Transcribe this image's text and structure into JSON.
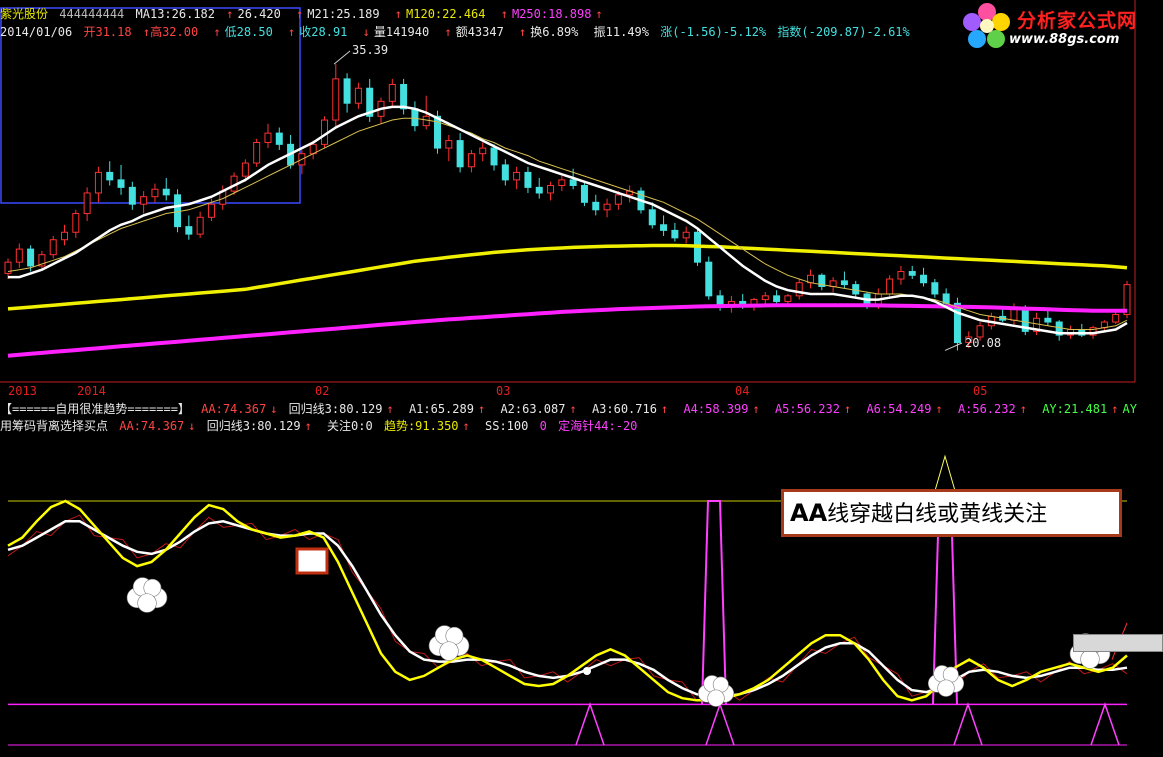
{
  "header": {
    "stock_name": "紫光股份",
    "code": "444444444",
    "ma13": "MA13:26.182",
    "ma13_arrow": "26.420",
    "ma21": "M21:25.189",
    "ma120": "M120:22.464",
    "ma250": "M250:18.898"
  },
  "quote": {
    "date": "2014/01/06",
    "open": "开31.18",
    "high": "高32.00",
    "low": "低28.50",
    "close": "收28.91",
    "volume": "量141940",
    "amount": "额43347",
    "turnover": "换6.89%",
    "amplitude": "振11.49%",
    "change": "涨(-1.56)-5.12%",
    "index": "指数(-209.87)-2.61%"
  },
  "indicator_row1": {
    "title": "【======自用很准趋势=======】",
    "aa": "AA:74.367",
    "huigui": "回归线3:80.129",
    "a1": "A1:65.289",
    "a2": "A2:63.087",
    "a3": "A3:60.716",
    "a4": "A4:58.399",
    "a5": "A5:56.232",
    "a6": "A6:54.249",
    "a": "A:56.232",
    "ay": "AY:21.481",
    "ay2": "AY"
  },
  "indicator_row2": {
    "title": "用筹码背离选择买点",
    "aa": "AA:74.367",
    "huigui": "回归线3:80.129",
    "guanzhu": "关注0:0",
    "qushi": "趋势:91.350",
    "ss": "SS:100",
    "zero": "0",
    "dinghai": "定海针44:-20"
  },
  "price_labels": {
    "high": "35.39",
    "low": "20.08"
  },
  "x_axis": [
    "2013",
    "2014",
    "02",
    "03",
    "04",
    "05"
  ],
  "logo": {
    "title": "分析家公式网",
    "url": "www.88gs.com"
  },
  "annotation": {
    "bold": "AA",
    "text": "线穿越白线或黄线关注"
  },
  "colors": {
    "up": "#ff3030",
    "down": "#44e0e0",
    "ma13": "#ffffff",
    "ma21": "#e8e8e8",
    "ma120": "#f0f000",
    "ma250": "#ff20ff",
    "aa": "#ffff00",
    "ref": "#ffffff"
  },
  "chart_data": [
    {
      "type": "candlestick",
      "title": "紫光股份",
      "x_ticks": [
        "2013",
        "2014",
        "02",
        "03",
        "04",
        "05"
      ],
      "ylim": [
        18.5,
        37
      ],
      "candles": [
        [
          24.2,
          25.0,
          23.9,
          24.8
        ],
        [
          24.8,
          25.8,
          24.5,
          25.5
        ],
        [
          25.5,
          25.7,
          24.3,
          24.6
        ],
        [
          24.6,
          25.4,
          24.4,
          25.2
        ],
        [
          25.2,
          26.2,
          25.0,
          26.0
        ],
        [
          26.0,
          26.8,
          25.7,
          26.4
        ],
        [
          26.4,
          27.6,
          26.1,
          27.4
        ],
        [
          27.4,
          28.8,
          27.0,
          28.5
        ],
        [
          28.5,
          29.9,
          28.0,
          29.6
        ],
        [
          29.6,
          30.2,
          28.9,
          29.2
        ],
        [
          29.2,
          30.0,
          28.4,
          28.8
        ],
        [
          28.8,
          29.1,
          27.6,
          27.9
        ],
        [
          27.9,
          28.6,
          27.4,
          28.3
        ],
        [
          28.3,
          29.0,
          28.0,
          28.7
        ],
        [
          28.7,
          29.3,
          28.1,
          28.4
        ],
        [
          28.4,
          28.7,
          26.4,
          26.7
        ],
        [
          26.7,
          27.3,
          26.0,
          26.3
        ],
        [
          26.3,
          27.5,
          26.1,
          27.2
        ],
        [
          27.2,
          28.2,
          27.0,
          27.9
        ],
        [
          27.9,
          28.9,
          27.6,
          28.6
        ],
        [
          28.6,
          29.6,
          28.4,
          29.4
        ],
        [
          29.4,
          30.3,
          29.1,
          30.1
        ],
        [
          30.1,
          31.4,
          29.9,
          31.2
        ],
        [
          31.2,
          32.2,
          30.9,
          31.7
        ],
        [
          31.7,
          32.0,
          30.8,
          31.1
        ],
        [
          31.1,
          31.6,
          29.8,
          30.0
        ],
        [
          30.0,
          30.8,
          29.5,
          30.6
        ],
        [
          30.6,
          31.3,
          30.3,
          31.1
        ],
        [
          31.1,
          32.6,
          30.9,
          32.4
        ],
        [
          32.4,
          35.39,
          32.0,
          34.6
        ],
        [
          34.6,
          34.9,
          32.8,
          33.3
        ],
        [
          33.3,
          34.4,
          33.0,
          34.1
        ],
        [
          34.1,
          34.6,
          32.3,
          32.6
        ],
        [
          32.6,
          33.6,
          32.2,
          33.4
        ],
        [
          33.4,
          34.6,
          33.1,
          34.3
        ],
        [
          34.3,
          34.6,
          32.7,
          33.0
        ],
        [
          33.0,
          33.4,
          31.8,
          32.1
        ],
        [
          32.1,
          33.7,
          31.9,
          32.6
        ],
        [
          32.6,
          32.9,
          30.6,
          30.9
        ],
        [
          30.9,
          31.6,
          30.2,
          31.3
        ],
        [
          31.3,
          31.7,
          29.6,
          29.9
        ],
        [
          29.9,
          30.8,
          29.6,
          30.6
        ],
        [
          30.6,
          31.2,
          30.2,
          30.9
        ],
        [
          30.9,
          31.1,
          29.7,
          30.0
        ],
        [
          30.0,
          30.3,
          28.9,
          29.2
        ],
        [
          29.2,
          29.9,
          28.7,
          29.6
        ],
        [
          29.6,
          29.9,
          28.5,
          28.8
        ],
        [
          28.8,
          29.3,
          28.2,
          28.5
        ],
        [
          28.5,
          29.1,
          28.1,
          28.9
        ],
        [
          28.9,
          29.4,
          28.6,
          29.2
        ],
        [
          29.2,
          29.8,
          28.7,
          28.9
        ],
        [
          28.9,
          29.1,
          27.8,
          28.0
        ],
        [
          28.0,
          28.4,
          27.3,
          27.6
        ],
        [
          27.6,
          28.2,
          27.2,
          27.9
        ],
        [
          27.9,
          28.6,
          27.6,
          28.4
        ],
        [
          28.4,
          28.9,
          28.0,
          28.6
        ],
        [
          28.6,
          28.8,
          27.4,
          27.6
        ],
        [
          27.6,
          28.0,
          26.6,
          26.8
        ],
        [
          26.8,
          27.3,
          26.2,
          26.5
        ],
        [
          26.5,
          26.9,
          25.9,
          26.1
        ],
        [
          26.1,
          26.7,
          25.8,
          26.4
        ],
        [
          26.4,
          26.6,
          24.6,
          24.8
        ],
        [
          24.8,
          25.1,
          22.8,
          23.0
        ],
        [
          23.0,
          23.3,
          22.2,
          22.4
        ],
        [
          22.4,
          23.0,
          22.1,
          22.7
        ],
        [
          22.7,
          23.1,
          22.3,
          22.5
        ],
        [
          22.5,
          22.9,
          22.2,
          22.8
        ],
        [
          22.8,
          23.2,
          22.5,
          23.0
        ],
        [
          23.0,
          23.3,
          22.6,
          22.7
        ],
        [
          22.7,
          23.1,
          22.4,
          23.0
        ],
        [
          23.0,
          23.9,
          22.8,
          23.7
        ],
        [
          23.7,
          24.4,
          23.4,
          24.1
        ],
        [
          24.1,
          24.2,
          23.3,
          23.5
        ],
        [
          23.5,
          24.0,
          23.2,
          23.8
        ],
        [
          23.8,
          24.3,
          23.4,
          23.6
        ],
        [
          23.6,
          23.8,
          22.9,
          23.1
        ],
        [
          23.1,
          23.2,
          22.3,
          22.5
        ],
        [
          22.5,
          23.4,
          22.3,
          23.1
        ],
        [
          23.1,
          24.1,
          22.9,
          23.9
        ],
        [
          23.9,
          24.6,
          23.6,
          24.3
        ],
        [
          24.3,
          24.6,
          23.9,
          24.1
        ],
        [
          24.1,
          24.5,
          23.5,
          23.7
        ],
        [
          23.7,
          23.9,
          22.9,
          23.1
        ],
        [
          23.1,
          23.4,
          22.4,
          22.6
        ],
        [
          22.6,
          22.9,
          20.08,
          20.5
        ],
        [
          20.5,
          21.1,
          20.2,
          20.8
        ],
        [
          20.8,
          21.6,
          20.6,
          21.4
        ],
        [
          21.4,
          22.1,
          21.2,
          21.9
        ],
        [
          21.9,
          22.3,
          21.6,
          21.7
        ],
        [
          21.7,
          22.6,
          21.4,
          22.3
        ],
        [
          22.3,
          22.5,
          20.9,
          21.1
        ],
        [
          21.1,
          22.1,
          20.9,
          21.8
        ],
        [
          21.8,
          22.2,
          21.4,
          21.6
        ],
        [
          21.6,
          21.7,
          20.6,
          20.9
        ],
        [
          20.9,
          21.4,
          20.7,
          21.2
        ],
        [
          21.2,
          21.5,
          20.8,
          20.9
        ],
        [
          20.9,
          21.4,
          20.7,
          21.3
        ],
        [
          21.3,
          21.7,
          21.1,
          21.6
        ],
        [
          21.6,
          22.2,
          21.5,
          22.0
        ],
        [
          22.0,
          23.8,
          21.8,
          23.6
        ]
      ],
      "ma_series": [
        {
          "name": "MA13",
          "values_first": 24.0,
          "values_last": 21.55
        },
        {
          "name": "M21",
          "values_first": 24.3,
          "values_last": 21.7
        },
        {
          "name": "M120",
          "values_first": 22.3,
          "values_last": 24.5
        },
        {
          "name": "M250",
          "values_first": 19.8,
          "values_last": 22.2
        }
      ],
      "ma13": [
        24.0,
        24.0,
        24.2,
        24.4,
        24.7,
        25.0,
        25.3,
        25.7,
        26.1,
        26.5,
        26.8,
        27.0,
        27.3,
        27.5,
        27.7,
        27.8,
        27.9,
        28.1,
        28.3,
        28.6,
        28.9,
        29.2,
        29.6,
        30.0,
        30.3,
        30.6,
        30.9,
        31.2,
        31.6,
        32.0,
        32.3,
        32.6,
        32.8,
        33.0,
        33.1,
        33.1,
        33.0,
        32.8,
        32.5,
        32.2,
        31.9,
        31.6,
        31.3,
        31.0,
        30.7,
        30.4,
        30.1,
        29.9,
        29.7,
        29.5,
        29.3,
        29.1,
        28.9,
        28.7,
        28.5,
        28.3,
        28.1,
        27.9,
        27.6,
        27.3,
        27.0,
        26.6,
        26.1,
        25.6,
        25.1,
        24.6,
        24.2,
        23.8,
        23.5,
        23.3,
        23.2,
        23.1,
        23.1,
        23.1,
        23.0,
        22.9,
        22.8,
        22.8,
        22.9,
        23.0,
        23.0,
        22.9,
        22.7,
        22.4,
        22.1,
        21.9,
        21.7,
        21.6,
        21.5,
        21.4,
        21.3,
        21.2,
        21.1,
        21.0,
        21.0,
        21.0,
        21.0,
        21.1,
        21.2,
        21.55
      ],
      "ma21": [
        24.3,
        24.4,
        24.5,
        24.7,
        24.9,
        25.1,
        25.4,
        25.7,
        26.0,
        26.3,
        26.6,
        26.8,
        27.0,
        27.2,
        27.4,
        27.5,
        27.6,
        27.8,
        28.0,
        28.2,
        28.5,
        28.8,
        29.1,
        29.4,
        29.7,
        30.0,
        30.3,
        30.6,
        30.9,
        31.2,
        31.5,
        31.8,
        32.0,
        32.2,
        32.4,
        32.5,
        32.5,
        32.4,
        32.3,
        32.1,
        31.9,
        31.7,
        31.4,
        31.2,
        30.9,
        30.7,
        30.5,
        30.2,
        30.0,
        29.8,
        29.6,
        29.4,
        29.2,
        29.0,
        28.8,
        28.6,
        28.4,
        28.2,
        28.0,
        27.7,
        27.4,
        27.1,
        26.7,
        26.3,
        25.9,
        25.5,
        25.1,
        24.7,
        24.4,
        24.1,
        23.9,
        23.7,
        23.6,
        23.5,
        23.4,
        23.3,
        23.2,
        23.1,
        23.1,
        23.1,
        23.0,
        22.9,
        22.8,
        22.6,
        22.4,
        22.2,
        22.0,
        21.9,
        21.8,
        21.7,
        21.6,
        21.5,
        21.4,
        21.3,
        21.2,
        21.2,
        21.2,
        21.3,
        21.4,
        21.7
      ],
      "ma120": [
        22.3,
        22.35,
        22.4,
        22.45,
        22.5,
        22.55,
        22.6,
        22.65,
        22.7,
        22.75,
        22.8,
        22.85,
        22.9,
        22.95,
        23.0,
        23.05,
        23.1,
        23.15,
        23.2,
        23.25,
        23.3,
        23.35,
        23.45,
        23.55,
        23.65,
        23.75,
        23.85,
        23.95,
        24.05,
        24.15,
        24.25,
        24.35,
        24.45,
        24.55,
        24.65,
        24.75,
        24.85,
        24.92,
        24.99,
        25.06,
        25.13,
        25.2,
        25.26,
        25.32,
        25.37,
        25.42,
        25.46,
        25.5,
        25.53,
        25.56,
        25.59,
        25.61,
        25.63,
        25.65,
        25.66,
        25.67,
        25.68,
        25.69,
        25.69,
        25.69,
        25.68,
        25.66,
        25.64,
        25.62,
        25.59,
        25.56,
        25.53,
        25.5,
        25.47,
        25.44,
        25.41,
        25.38,
        25.35,
        25.32,
        25.29,
        25.26,
        25.23,
        25.2,
        25.17,
        25.14,
        25.11,
        25.08,
        25.05,
        25.02,
        24.99,
        24.96,
        24.93,
        24.9,
        24.87,
        24.84,
        24.81,
        24.78,
        24.75,
        24.72,
        24.69,
        24.66,
        24.63,
        24.6,
        24.55,
        24.5
      ],
      "ma250": [
        19.8,
        19.85,
        19.9,
        19.95,
        20.0,
        20.05,
        20.1,
        20.15,
        20.2,
        20.25,
        20.3,
        20.35,
        20.4,
        20.45,
        20.5,
        20.55,
        20.6,
        20.65,
        20.7,
        20.75,
        20.8,
        20.85,
        20.9,
        20.95,
        21.0,
        21.05,
        21.1,
        21.15,
        21.2,
        21.25,
        21.3,
        21.35,
        21.4,
        21.45,
        21.5,
        21.55,
        21.6,
        21.65,
        21.7,
        21.74,
        21.78,
        21.82,
        21.86,
        21.9,
        21.94,
        21.98,
        22.02,
        22.06,
        22.1,
        22.14,
        22.17,
        22.2,
        22.23,
        22.26,
        22.29,
        22.31,
        22.33,
        22.35,
        22.37,
        22.39,
        22.41,
        22.43,
        22.44,
        22.45,
        22.46,
        22.47,
        22.48,
        22.49,
        22.5,
        22.5,
        22.5,
        22.5,
        22.5,
        22.5,
        22.5,
        22.5,
        22.5,
        22.49,
        22.48,
        22.47,
        22.46,
        22.45,
        22.44,
        22.43,
        22.42,
        22.41,
        22.4,
        22.38,
        22.36,
        22.34,
        22.32,
        22.3,
        22.28,
        22.26,
        22.24,
        22.22,
        22.2,
        22.2,
        22.2,
        22.2
      ]
    },
    {
      "type": "line",
      "title": "用筹码背离选择买点",
      "ylim": [
        -20,
        130
      ],
      "series": [
        {
          "name": "AA",
          "values": [
            78,
            82,
            90,
            97,
            100,
            96,
            88,
            80,
            72,
            68,
            70,
            76,
            84,
            92,
            98,
            96,
            90,
            86,
            84,
            82,
            83,
            85,
            82,
            70,
            55,
            40,
            25,
            16,
            12,
            14,
            18,
            22,
            24,
            22,
            18,
            14,
            10,
            9,
            10,
            14,
            19,
            24,
            27,
            24,
            18,
            12,
            6,
            3,
            2,
            2,
            3,
            5,
            8,
            12,
            18,
            24,
            30,
            34,
            34,
            30,
            22,
            12,
            4,
            2,
            4,
            10,
            18,
            22,
            18,
            12,
            9,
            12,
            16,
            18,
            20,
            18,
            16,
            18,
            24
          ]
        },
        {
          "name": "回归线3",
          "values": [
            76,
            78,
            82,
            86,
            90,
            90,
            86,
            82,
            78,
            75,
            74,
            76,
            80,
            85,
            89,
            90,
            88,
            86,
            84,
            83,
            83,
            84,
            84,
            78,
            68,
            56,
            44,
            34,
            26,
            22,
            21,
            21,
            22,
            22,
            21,
            19,
            16,
            14,
            13,
            14,
            16,
            19,
            22,
            22,
            20,
            17,
            12,
            8,
            5,
            4,
            4,
            5,
            7,
            10,
            14,
            19,
            24,
            28,
            30,
            30,
            26,
            19,
            12,
            7,
            6,
            8,
            12,
            16,
            17,
            16,
            14,
            13,
            14,
            16,
            18,
            18,
            17,
            17,
            18
          ]
        }
      ]
    }
  ]
}
